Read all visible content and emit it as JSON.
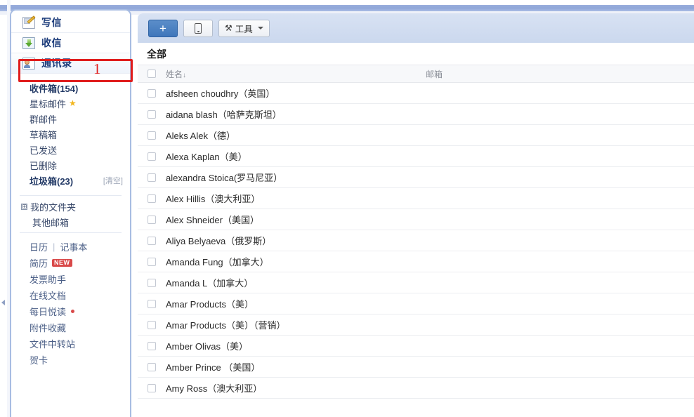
{
  "sidebar": {
    "nav": [
      {
        "label": "写信",
        "icon": "compose-icon"
      },
      {
        "label": "收信",
        "icon": "receive-icon"
      },
      {
        "label": "通讯录",
        "icon": "contacts-icon"
      }
    ],
    "annotation": {
      "number": "1",
      "color": "#e01d1d"
    },
    "folders": [
      {
        "label": "收件箱(154)",
        "bold": true,
        "star": false,
        "action": ""
      },
      {
        "label": "星标邮件",
        "bold": false,
        "star": true,
        "action": ""
      },
      {
        "label": "群邮件",
        "bold": false,
        "star": false,
        "action": ""
      },
      {
        "label": "草稿箱",
        "bold": false,
        "star": false,
        "action": ""
      },
      {
        "label": "已发送",
        "bold": false,
        "star": false,
        "action": ""
      },
      {
        "label": "已删除",
        "bold": false,
        "star": false,
        "action": ""
      },
      {
        "label": "垃圾箱(23)",
        "bold": true,
        "star": false,
        "action": "[清空]"
      }
    ],
    "my_folder": {
      "label": "我的文件夹",
      "expander": "⊞"
    },
    "other_mailbox": {
      "label": "其他邮箱"
    },
    "tools": [
      {
        "label": "日历",
        "sep": "|",
        "label2": "记事本",
        "badge": "",
        "dot": false
      },
      {
        "label": "简历",
        "badge": "NEW",
        "dot": false
      },
      {
        "label": "发票助手",
        "badge": "",
        "dot": false
      },
      {
        "label": "在线文档",
        "badge": "",
        "dot": false
      },
      {
        "label": "每日悦读",
        "badge": "",
        "dot": true
      },
      {
        "label": "附件收藏",
        "badge": "",
        "dot": false
      },
      {
        "label": "文件中转站",
        "badge": "",
        "dot": false
      },
      {
        "label": "贺卡",
        "badge": "",
        "dot": false
      }
    ]
  },
  "toolbar": {
    "add_label": "+",
    "mobile_label": "",
    "tools_label": "工具"
  },
  "main": {
    "section_title": "全部",
    "columns": {
      "name": "姓名",
      "sort": "↓",
      "email": "邮箱"
    },
    "contacts": [
      {
        "name": "afsheen choudhry（英国）",
        "email": ""
      },
      {
        "name": "aidana blash（哈萨克斯坦）",
        "email": ""
      },
      {
        "name": "Aleks Alek（德）",
        "email": ""
      },
      {
        "name": " Alexa Kaplan（美）",
        "email": ""
      },
      {
        "name": "alexandra Stoica(罗马尼亚）",
        "email": ""
      },
      {
        "name": "Alex Hillis（澳大利亚）",
        "email": ""
      },
      {
        "name": "Alex Shneider（美国）",
        "email": ""
      },
      {
        "name": "Aliya Belyaeva（俄罗斯）",
        "email": ""
      },
      {
        "name": "Amanda Fung（加拿大）",
        "email": ""
      },
      {
        "name": "Amanda L（加拿大）",
        "email": ""
      },
      {
        "name": "Amar Products（美）",
        "email": ""
      },
      {
        "name": "Amar Products（美）（营销）",
        "email": ""
      },
      {
        "name": " Amber Olivas（美）",
        "email": ""
      },
      {
        "name": "Amber Prince  （美国）",
        "email": ""
      },
      {
        "name": " Amy Ross（澳大利亚）",
        "email": ""
      }
    ]
  }
}
